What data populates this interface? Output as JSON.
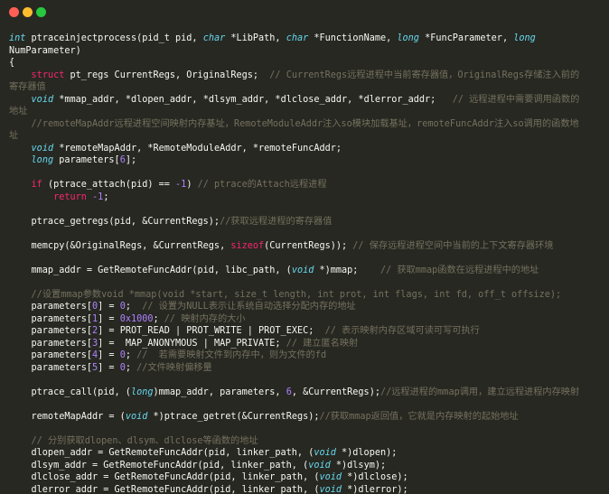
{
  "window": {
    "title_dots": [
      "close",
      "minimize",
      "maximize"
    ]
  },
  "code_lines": [
    [
      [
        "kw",
        "int"
      ],
      [
        "plain",
        " ptraceinjectprocess(pid_t pid, "
      ],
      [
        "kw",
        "char"
      ],
      [
        "plain",
        " *LibPath, "
      ],
      [
        "kw",
        "char"
      ],
      [
        "plain",
        " *FunctionName, "
      ],
      [
        "kw",
        "long"
      ],
      [
        "plain",
        " *FuncParameter, "
      ],
      [
        "kw",
        "long"
      ]
    ],
    [
      [
        "plain",
        "NumParameter)"
      ]
    ],
    [
      [
        "plain",
        "{"
      ]
    ],
    [
      [
        "plain",
        "    "
      ],
      [
        "kw2",
        "struct"
      ],
      [
        "plain",
        " pt_regs CurrentRegs, OriginalRegs;  "
      ],
      [
        "cm",
        "// CurrentRegs远程进程中当前寄存器值，OriginalRegs存储注入前的"
      ]
    ],
    [
      [
        "cm",
        "寄存器值"
      ]
    ],
    [
      [
        "plain",
        "    "
      ],
      [
        "kw",
        "void"
      ],
      [
        "plain",
        " *mmap_addr, *dlopen_addr, *dlsym_addr, *dlclose_addr, *dlerror_addr;   "
      ],
      [
        "cm",
        "// 远程进程中需要调用函数的"
      ]
    ],
    [
      [
        "cm",
        "地址"
      ]
    ],
    [
      [
        "plain",
        "    "
      ],
      [
        "cm",
        "//remoteMapAddr远程进程空间映射内存基址，RemoteModuleAddr注入so模块加载基址，remoteFuncAddr注入so调用的函数地"
      ]
    ],
    [
      [
        "cm",
        "址"
      ]
    ],
    [
      [
        "plain",
        "    "
      ],
      [
        "kw",
        "void"
      ],
      [
        "plain",
        " *remoteMapAddr, *RemoteModuleAddr, *remoteFuncAddr;"
      ]
    ],
    [
      [
        "plain",
        "    "
      ],
      [
        "kw",
        "long"
      ],
      [
        "plain",
        " parameters["
      ],
      [
        "num",
        "6"
      ],
      [
        "plain",
        "];"
      ]
    ],
    [
      [
        "plain",
        ""
      ]
    ],
    [
      [
        "plain",
        "    "
      ],
      [
        "kw2",
        "if"
      ],
      [
        "plain",
        " (ptrace_attach(pid) == "
      ],
      [
        "num",
        "-1"
      ],
      [
        "plain",
        ") "
      ],
      [
        "cm",
        "// ptrace的Attach远程进程"
      ]
    ],
    [
      [
        "plain",
        "        "
      ],
      [
        "kw2",
        "return"
      ],
      [
        "plain",
        " "
      ],
      [
        "num",
        "-1"
      ],
      [
        "plain",
        ";"
      ]
    ],
    [
      [
        "plain",
        ""
      ]
    ],
    [
      [
        "plain",
        "    ptrace_getregs(pid, &CurrentRegs);"
      ],
      [
        "cm",
        "//获取远程进程的寄存器值"
      ]
    ],
    [
      [
        "plain",
        ""
      ]
    ],
    [
      [
        "plain",
        "    memcpy(&OriginalRegs, &CurrentRegs, "
      ],
      [
        "kw2",
        "sizeof"
      ],
      [
        "plain",
        "(CurrentRegs)); "
      ],
      [
        "cm",
        "// 保存远程进程空间中当前的上下文寄存器环境"
      ]
    ],
    [
      [
        "plain",
        ""
      ]
    ],
    [
      [
        "plain",
        "    mmap_addr = GetRemoteFuncAddr(pid, libc_path, ("
      ],
      [
        "kw",
        "void"
      ],
      [
        "plain",
        " *)mmap;    "
      ],
      [
        "cm",
        "// 获取mmap函数在远程进程中的地址"
      ]
    ],
    [
      [
        "plain",
        ""
      ]
    ],
    [
      [
        "plain",
        "    "
      ],
      [
        "cm",
        "//设置mmap参数void *mmap(void *start, size_t length, int prot, int flags, int fd, off_t offsize);"
      ]
    ],
    [
      [
        "plain",
        "    parameters["
      ],
      [
        "num",
        "0"
      ],
      [
        "plain",
        "] = "
      ],
      [
        "num",
        "0"
      ],
      [
        "plain",
        ";  "
      ],
      [
        "cm",
        "// 设置为NULL表示让系统自动选择分配内存的地址"
      ]
    ],
    [
      [
        "plain",
        "    parameters["
      ],
      [
        "num",
        "1"
      ],
      [
        "plain",
        "] = "
      ],
      [
        "num",
        "0x1000"
      ],
      [
        "plain",
        "; "
      ],
      [
        "cm",
        "// 映射内存的大小"
      ]
    ],
    [
      [
        "plain",
        "    parameters["
      ],
      [
        "num",
        "2"
      ],
      [
        "plain",
        "] = PROT_READ | PROT_WRITE | PROT_EXEC;  "
      ],
      [
        "cm",
        "// 表示映射内存区域可读可写可执行"
      ]
    ],
    [
      [
        "plain",
        "    parameters["
      ],
      [
        "num",
        "3"
      ],
      [
        "plain",
        "] =  MAP_ANONYMOUS | MAP_PRIVATE; "
      ],
      [
        "cm",
        "// 建立匿名映射"
      ]
    ],
    [
      [
        "plain",
        "    parameters["
      ],
      [
        "num",
        "4"
      ],
      [
        "plain",
        "] = "
      ],
      [
        "num",
        "0"
      ],
      [
        "plain",
        "; "
      ],
      [
        "cm",
        "//  若需要映射文件到内存中，则为文件的fd"
      ]
    ],
    [
      [
        "plain",
        "    parameters["
      ],
      [
        "num",
        "5"
      ],
      [
        "plain",
        "] = "
      ],
      [
        "num",
        "0"
      ],
      [
        "plain",
        "; "
      ],
      [
        "cm",
        "//文件映射偏移量"
      ]
    ],
    [
      [
        "plain",
        ""
      ]
    ],
    [
      [
        "plain",
        "    ptrace_call(pid, ("
      ],
      [
        "kw",
        "long"
      ],
      [
        "plain",
        ")mmap_addr, parameters, "
      ],
      [
        "num",
        "6"
      ],
      [
        "plain",
        ", &CurrentRegs);"
      ],
      [
        "cm",
        "//远程进程的mmap调用，建立远程进程内存映射"
      ]
    ],
    [
      [
        "plain",
        ""
      ]
    ],
    [
      [
        "plain",
        "    remoteMapAddr = ("
      ],
      [
        "kw",
        "void"
      ],
      [
        "plain",
        " *)ptrace_getret(&CurrentRegs);"
      ],
      [
        "cm",
        "//获取mmap返回值，它就是内存映射的起始地址"
      ]
    ],
    [
      [
        "plain",
        ""
      ]
    ],
    [
      [
        "plain",
        "    "
      ],
      [
        "cm",
        "// 分别获取dlopen、dlsym、dlclose等函数的地址"
      ]
    ],
    [
      [
        "plain",
        "    dlopen_addr = GetRemoteFuncAddr(pid, linker_path, ("
      ],
      [
        "kw",
        "void"
      ],
      [
        "plain",
        " *)dlopen);"
      ]
    ],
    [
      [
        "plain",
        "    dlsym_addr = GetRemoteFuncAddr(pid, linker_path, ("
      ],
      [
        "kw",
        "void"
      ],
      [
        "plain",
        " *)dlsym);"
      ]
    ],
    [
      [
        "plain",
        "    dlclose_addr = GetRemoteFuncAddr(pid, linker_path, ("
      ],
      [
        "kw",
        "void"
      ],
      [
        "plain",
        " *)dlclose);"
      ]
    ],
    [
      [
        "plain",
        "    dlerror_addr = GetRemoteFuncAddr(pid, linker_path, ("
      ],
      [
        "kw",
        "void"
      ],
      [
        "plain",
        " *)dlerror);"
      ]
    ]
  ],
  "colors": {
    "background": "#272822",
    "keyword": "#66d9ef",
    "control_keyword": "#f92672",
    "number": "#ae81ff",
    "comment": "#75715e",
    "text": "#f8f8f2"
  }
}
